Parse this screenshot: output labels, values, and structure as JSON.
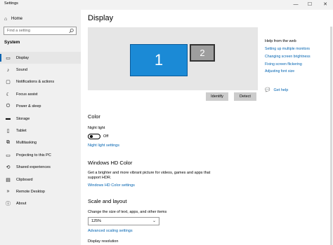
{
  "window": {
    "title": "Settings",
    "minimize": "—",
    "maximize": "☐",
    "close": "✕"
  },
  "sidebar": {
    "home_label": "Home",
    "search_placeholder": "Find a setting",
    "section_label": "System",
    "items": [
      {
        "label": "Display",
        "icon": "monitor-icon",
        "glyph": "▭",
        "active": true
      },
      {
        "label": "Sound",
        "icon": "speaker-icon",
        "glyph": "♪",
        "active": false
      },
      {
        "label": "Notifications & actions",
        "icon": "notifications-icon",
        "glyph": "▢",
        "active": false
      },
      {
        "label": "Focus assist",
        "icon": "moon-icon",
        "glyph": "☾",
        "active": false
      },
      {
        "label": "Power & sleep",
        "icon": "power-icon",
        "glyph": "⏻",
        "active": false
      },
      {
        "label": "Storage",
        "icon": "storage-icon",
        "glyph": "▬",
        "active": false
      },
      {
        "label": "Tablet",
        "icon": "tablet-icon",
        "glyph": "▯",
        "active": false
      },
      {
        "label": "Multitasking",
        "icon": "multitasking-icon",
        "glyph": "⧉",
        "active": false
      },
      {
        "label": "Projecting to this PC",
        "icon": "projecting-icon",
        "glyph": "▭",
        "active": false
      },
      {
        "label": "Shared experiences",
        "icon": "shared-icon",
        "glyph": "⟲",
        "active": false
      },
      {
        "label": "Clipboard",
        "icon": "clipboard-icon",
        "glyph": "▤",
        "active": false
      },
      {
        "label": "Remote Desktop",
        "icon": "remote-desktop-icon",
        "glyph": "»",
        "active": false
      },
      {
        "label": "About",
        "icon": "info-icon",
        "glyph": "ⓘ",
        "active": false
      }
    ]
  },
  "main": {
    "title": "Display",
    "monitors": {
      "primary": "1",
      "secondary": "2"
    },
    "identify_label": "Identify",
    "detect_label": "Detect",
    "color": {
      "heading": "Color",
      "night_light_label": "Night light",
      "night_light_state": "Off",
      "night_light_settings_link": "Night light settings"
    },
    "hdr": {
      "heading": "Windows HD Color",
      "description": "Get a brighter and more vibrant picture for videos, games and apps that support HDR.",
      "settings_link": "Windows HD Color settings"
    },
    "scale": {
      "heading": "Scale and layout",
      "size_label": "Change the size of text, apps, and other items",
      "size_value": "125%",
      "advanced_link": "Advanced scaling settings",
      "resolution_label": "Display resolution"
    }
  },
  "help": {
    "title": "Help from the web",
    "links": [
      "Setting up multiple monitors",
      "Changing screen brightness",
      "Fixing screen flickering",
      "Adjusting font size"
    ],
    "get_help": "Get help"
  },
  "colors": {
    "accent": "#0063b1",
    "monitor_primary": "#1b8ad6",
    "monitor_secondary": "#9e9e9e",
    "sidebar_bg": "#f0f0f0"
  }
}
